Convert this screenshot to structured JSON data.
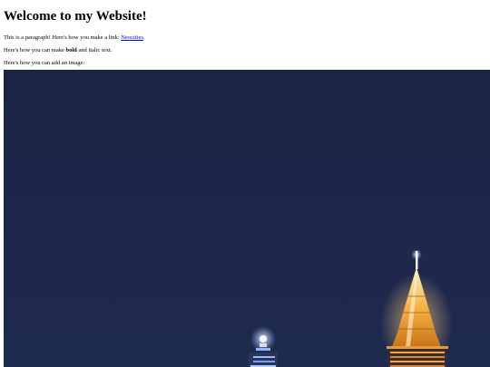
{
  "page": {
    "heading": "Welcome to my Website!",
    "p1": {
      "before": "This is a paragraph! Here's how you make a link: ",
      "link_text": "Neocities",
      "after": "."
    },
    "p2": {
      "before": "Here's how you can make ",
      "bold": "bold",
      "middle": " and ",
      "italic": "italic",
      "after": " text."
    },
    "p3": {
      "text": "Here's how you can add an image:"
    }
  },
  "image": {
    "subject": "city-skyline-at-night",
    "sky_color": "#1c2647",
    "tower_light_color": "#f2a23a",
    "spire_light_color": "#dfe8ff"
  },
  "colors": {
    "link": "#0000ee",
    "text": "#000000",
    "background": "#ffffff"
  }
}
